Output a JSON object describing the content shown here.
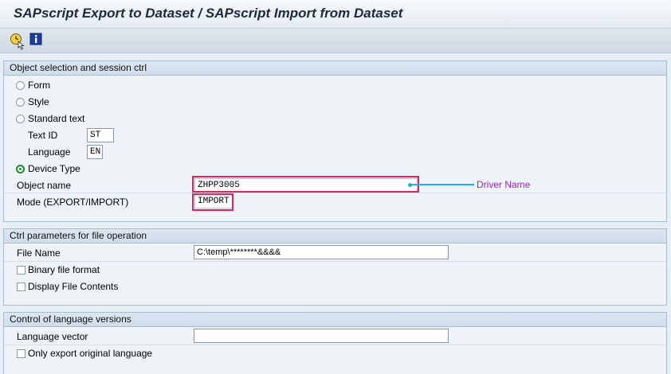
{
  "window": {
    "title": "SAPscript Export to Dataset / SAPscript Import from Dataset"
  },
  "toolbar": {
    "execute_icon": "execute-clock-icon",
    "info_icon": "info-icon"
  },
  "group1": {
    "header": "Object selection and session ctrl",
    "radio_form": "Form",
    "radio_style": "Style",
    "radio_standard_text": "Standard text",
    "text_id_label": "Text ID",
    "text_id_value": "ST",
    "language_label": "Language",
    "language_value": "EN",
    "radio_device_type": "Device Type",
    "selected_radio": "Device Type",
    "object_name_label": "Object name",
    "object_name_value": "ZHPP3005",
    "mode_label": "Mode (EXPORT/IMPORT)",
    "mode_value": "IMPORT"
  },
  "annotation": {
    "text": "Driver Name",
    "line_color": "#1cb4e6",
    "text_color": "#9b1fd6",
    "highlight_color": "#e0245e"
  },
  "group2": {
    "header": "Ctrl parameters for file operation",
    "file_name_label": "File Name",
    "file_name_value": "C:\\temp\\********&&&&",
    "binary_label": "Binary file format",
    "display_label": "Display File Contents"
  },
  "group3": {
    "header": "Control of language versions",
    "language_vector_label": "Language vector",
    "language_vector_value": "",
    "only_export_label": "Only export original language"
  }
}
